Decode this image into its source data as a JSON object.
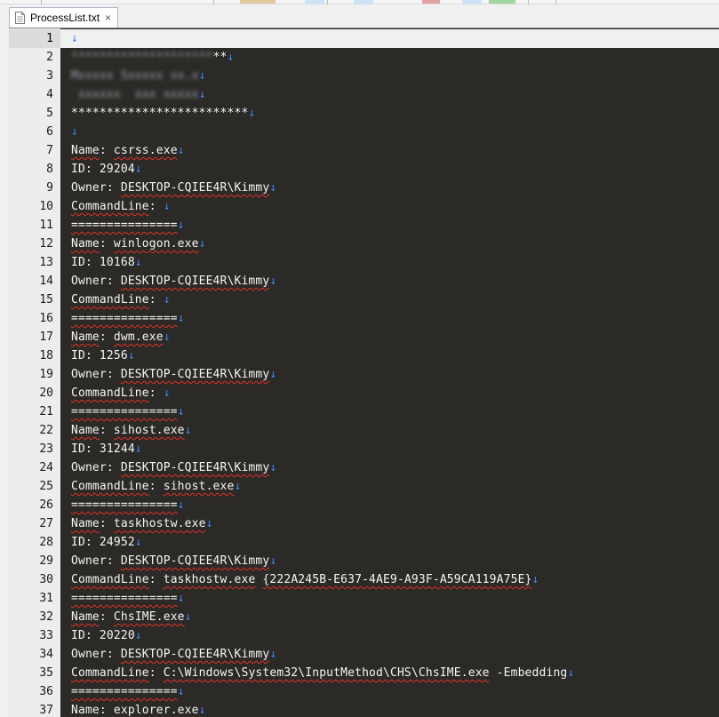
{
  "tab": {
    "filename": "ProcessList.txt",
    "close_glyph": "×"
  },
  "editor": {
    "eol_glyph": "↓",
    "current_line": 1,
    "lines": [
      {
        "num": "1",
        "segments": []
      },
      {
        "num": "2",
        "segments": [
          {
            "text": "********************",
            "blur": true
          },
          {
            "text": "**"
          }
        ]
      },
      {
        "num": "3",
        "segments": [
          {
            "text": "Mxxxxx Sxxxxx xx.x",
            "blur": true
          }
        ]
      },
      {
        "num": "4",
        "segments": [
          {
            "text": " xxxxxx  xxx xxxxx",
            "blur": true
          }
        ]
      },
      {
        "num": "5",
        "segments": [
          {
            "text": "*************************"
          }
        ]
      },
      {
        "num": "6",
        "segments": []
      },
      {
        "num": "7",
        "segments": [
          {
            "text": "Name",
            "sq": true
          },
          {
            "text": ": "
          },
          {
            "text": "csrss.exe",
            "sq": true
          }
        ]
      },
      {
        "num": "8",
        "segments": [
          {
            "text": "ID: 29204"
          }
        ]
      },
      {
        "num": "9",
        "segments": [
          {
            "text": "Owner: "
          },
          {
            "text": "DESKTOP-CQIEE4R\\Kimmy",
            "sq": true
          }
        ]
      },
      {
        "num": "10",
        "segments": [
          {
            "text": "CommandLine",
            "sq": true
          },
          {
            "text": ": "
          }
        ]
      },
      {
        "num": "11",
        "segments": [
          {
            "text": "===============",
            "sq": true
          }
        ]
      },
      {
        "num": "12",
        "segments": [
          {
            "text": "Name",
            "sq": true
          },
          {
            "text": ": "
          },
          {
            "text": "winlogon.exe",
            "sq": true
          }
        ]
      },
      {
        "num": "13",
        "segments": [
          {
            "text": "ID: 10168"
          }
        ]
      },
      {
        "num": "14",
        "segments": [
          {
            "text": "Owner: "
          },
          {
            "text": "DESKTOP-CQIEE4R\\Kimmy",
            "sq": true
          }
        ]
      },
      {
        "num": "15",
        "segments": [
          {
            "text": "CommandLine",
            "sq": true
          },
          {
            "text": ": "
          }
        ]
      },
      {
        "num": "16",
        "segments": [
          {
            "text": "===============",
            "sq": true
          }
        ]
      },
      {
        "num": "17",
        "segments": [
          {
            "text": "Name",
            "sq": true
          },
          {
            "text": ": "
          },
          {
            "text": "dwm.exe",
            "sq": true
          }
        ]
      },
      {
        "num": "18",
        "segments": [
          {
            "text": "ID: 1256"
          }
        ]
      },
      {
        "num": "19",
        "segments": [
          {
            "text": "Owner: "
          },
          {
            "text": "DESKTOP-CQIEE4R\\Kimmy",
            "sq": true
          }
        ]
      },
      {
        "num": "20",
        "segments": [
          {
            "text": "CommandLine",
            "sq": true
          },
          {
            "text": ": "
          }
        ]
      },
      {
        "num": "21",
        "segments": [
          {
            "text": "===============",
            "sq": true
          }
        ]
      },
      {
        "num": "22",
        "segments": [
          {
            "text": "Name",
            "sq": true
          },
          {
            "text": ": "
          },
          {
            "text": "sihost.exe",
            "sq": true
          }
        ]
      },
      {
        "num": "23",
        "segments": [
          {
            "text": "ID: 31244"
          }
        ]
      },
      {
        "num": "24",
        "segments": [
          {
            "text": "Owner: "
          },
          {
            "text": "DESKTOP-CQIEE4R\\Kimmy",
            "sq": true
          }
        ]
      },
      {
        "num": "25",
        "segments": [
          {
            "text": "CommandLine",
            "sq": true
          },
          {
            "text": ": "
          },
          {
            "text": "sihost.exe",
            "sq": true
          }
        ]
      },
      {
        "num": "26",
        "segments": [
          {
            "text": "===============",
            "sq": true
          }
        ]
      },
      {
        "num": "27",
        "segments": [
          {
            "text": "Name",
            "sq": true
          },
          {
            "text": ": "
          },
          {
            "text": "taskhostw.exe",
            "sq": true
          }
        ]
      },
      {
        "num": "28",
        "segments": [
          {
            "text": "ID: 24952"
          }
        ]
      },
      {
        "num": "29",
        "segments": [
          {
            "text": "Owner: "
          },
          {
            "text": "DESKTOP-CQIEE4R\\Kimmy",
            "sq": true
          }
        ]
      },
      {
        "num": "30",
        "segments": [
          {
            "text": "CommandLine",
            "sq": true
          },
          {
            "text": ": "
          },
          {
            "text": "taskhostw.exe",
            "sq": true
          },
          {
            "text": " "
          },
          {
            "text": "{222A245B-E637-4AE9-A93F-A59CA119A75E}",
            "sq": true
          }
        ]
      },
      {
        "num": "31",
        "segments": [
          {
            "text": "===============",
            "sq": true
          }
        ]
      },
      {
        "num": "32",
        "segments": [
          {
            "text": "Name",
            "sq": true
          },
          {
            "text": ": "
          },
          {
            "text": "ChsIME.exe",
            "sq": true
          }
        ]
      },
      {
        "num": "33",
        "segments": [
          {
            "text": "ID: 20220"
          }
        ]
      },
      {
        "num": "34",
        "segments": [
          {
            "text": "Owner: "
          },
          {
            "text": "DESKTOP-CQIEE4R\\Kimmy",
            "sq": true
          }
        ]
      },
      {
        "num": "35",
        "segments": [
          {
            "text": "CommandLine",
            "sq": true
          },
          {
            "text": ": "
          },
          {
            "text": "C:\\Windows\\System32\\InputMethod\\CHS\\ChsIME.exe",
            "sq": true
          },
          {
            "text": " -Embedding"
          }
        ]
      },
      {
        "num": "36",
        "segments": [
          {
            "text": "===============",
            "sq": true
          }
        ]
      },
      {
        "num": "37",
        "segments": [
          {
            "text": "Name",
            "sq": true
          },
          {
            "text": ": "
          },
          {
            "text": "explorer.exe",
            "sq": true
          }
        ]
      }
    ]
  }
}
